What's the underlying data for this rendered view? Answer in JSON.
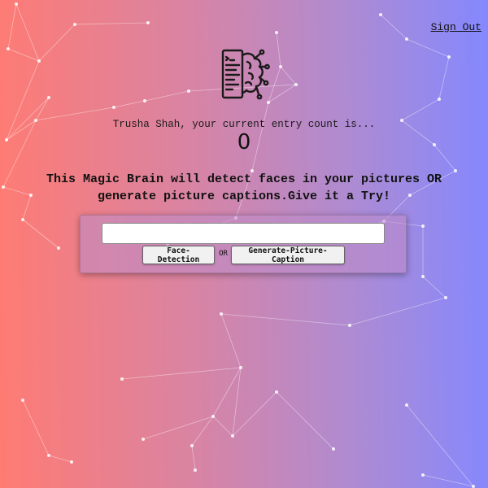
{
  "nav": {
    "signout_label": "Sign Out"
  },
  "profile": {
    "greeting": "Trusha Shah, your current entry count is...",
    "entry_count": "0"
  },
  "intro": {
    "tagline": "This Magic Brain will detect faces in your pictures OR generate picture captions.Give it a Try!"
  },
  "form": {
    "url_value": "",
    "url_placeholder": "",
    "face_button_label": "Face-Detection",
    "or_label": "OR",
    "caption_button_label": "Generate-Picture-Caption"
  },
  "icons": {
    "logo": "brain-code-icon"
  },
  "colors": {
    "gradient_start": "#ff7b73",
    "gradient_end": "#8488ff",
    "particle": "#ffffff"
  }
}
